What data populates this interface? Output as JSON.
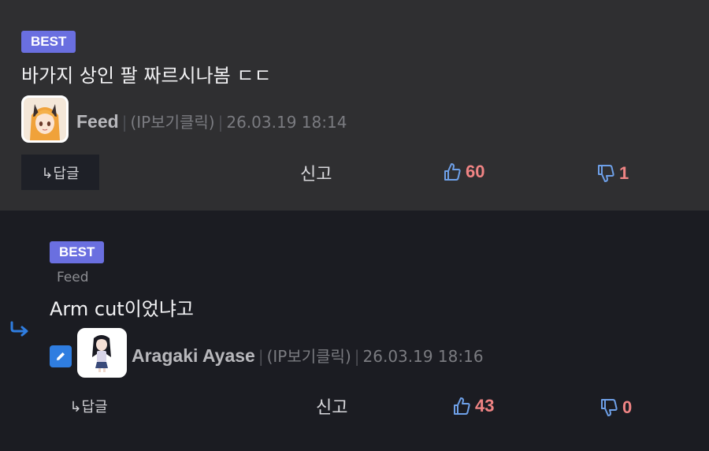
{
  "comments": [
    {
      "badge": "BEST",
      "text": "바가지 상인 팔 짜르시나봄 ㄷㄷ",
      "author": "Feed",
      "ip": "(IP보기클릭)",
      "date": "26.03.19 18:14",
      "reply_label": "↳답글",
      "report_label": "신고",
      "likes": "60",
      "dislikes": "1"
    },
    {
      "badge": "BEST",
      "reply_to": "Feed",
      "text": "Arm cut이었냐고",
      "author": "Aragaki Ayase",
      "ip": "(IP보기클릭)",
      "date": "26.03.19 18:16",
      "reply_label": "↳답글",
      "report_label": "신고",
      "likes": "43",
      "dislikes": "0"
    }
  ],
  "colors": {
    "badge": "#6a6fe0",
    "vote_count": "#f08484",
    "thumb_icon": "#6ea0e8",
    "reply_arrow": "#2f7de0"
  }
}
